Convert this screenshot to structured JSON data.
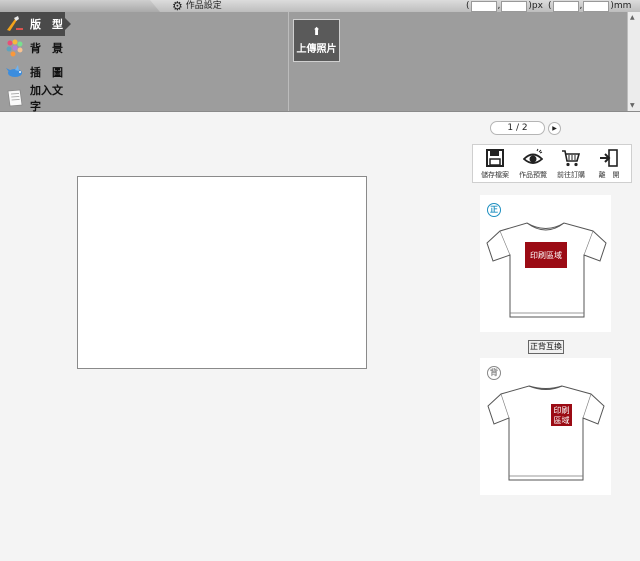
{
  "top": {
    "settings_label": "作品設定",
    "dim_open": "(",
    "dim_comma": ",",
    "px_suffix": ")px",
    "mm_suffix": ")mm",
    "px_w": "",
    "px_h": "",
    "mm_w": "",
    "mm_h": ""
  },
  "sidebar": {
    "items": [
      {
        "label": "版　型",
        "icon": "layout-brush-icon",
        "active": true
      },
      {
        "label": "背　景",
        "icon": "palette-icon",
        "active": false
      },
      {
        "label": "插　圖",
        "icon": "bird-icon",
        "active": false
      },
      {
        "label": "加入文字",
        "icon": "text-page-icon",
        "active": false
      }
    ]
  },
  "toolbar": {
    "upload_label": "上傳照片",
    "upload_icon": "up-arrow-icon"
  },
  "pager": {
    "text": "1 / 2",
    "next_icon": "play-arrow-icon"
  },
  "actions": [
    {
      "label": "儲存檔案",
      "icon": "save-icon"
    },
    {
      "label": "作品預覽",
      "icon": "eye-icon"
    },
    {
      "label": "前往訂購",
      "icon": "cart-icon"
    },
    {
      "label": "離　開",
      "icon": "exit-icon"
    }
  ],
  "front_preview": {
    "badge": "正",
    "print_area": "印刷區域",
    "accent": "#1e8fc0",
    "print_color": "#9b0b14"
  },
  "swap_label": "正背互換",
  "back_preview": {
    "badge": "背",
    "print_area_line1": "印刷",
    "print_area_line2": "區域",
    "accent": "#888888",
    "print_color": "#9b0b14"
  }
}
